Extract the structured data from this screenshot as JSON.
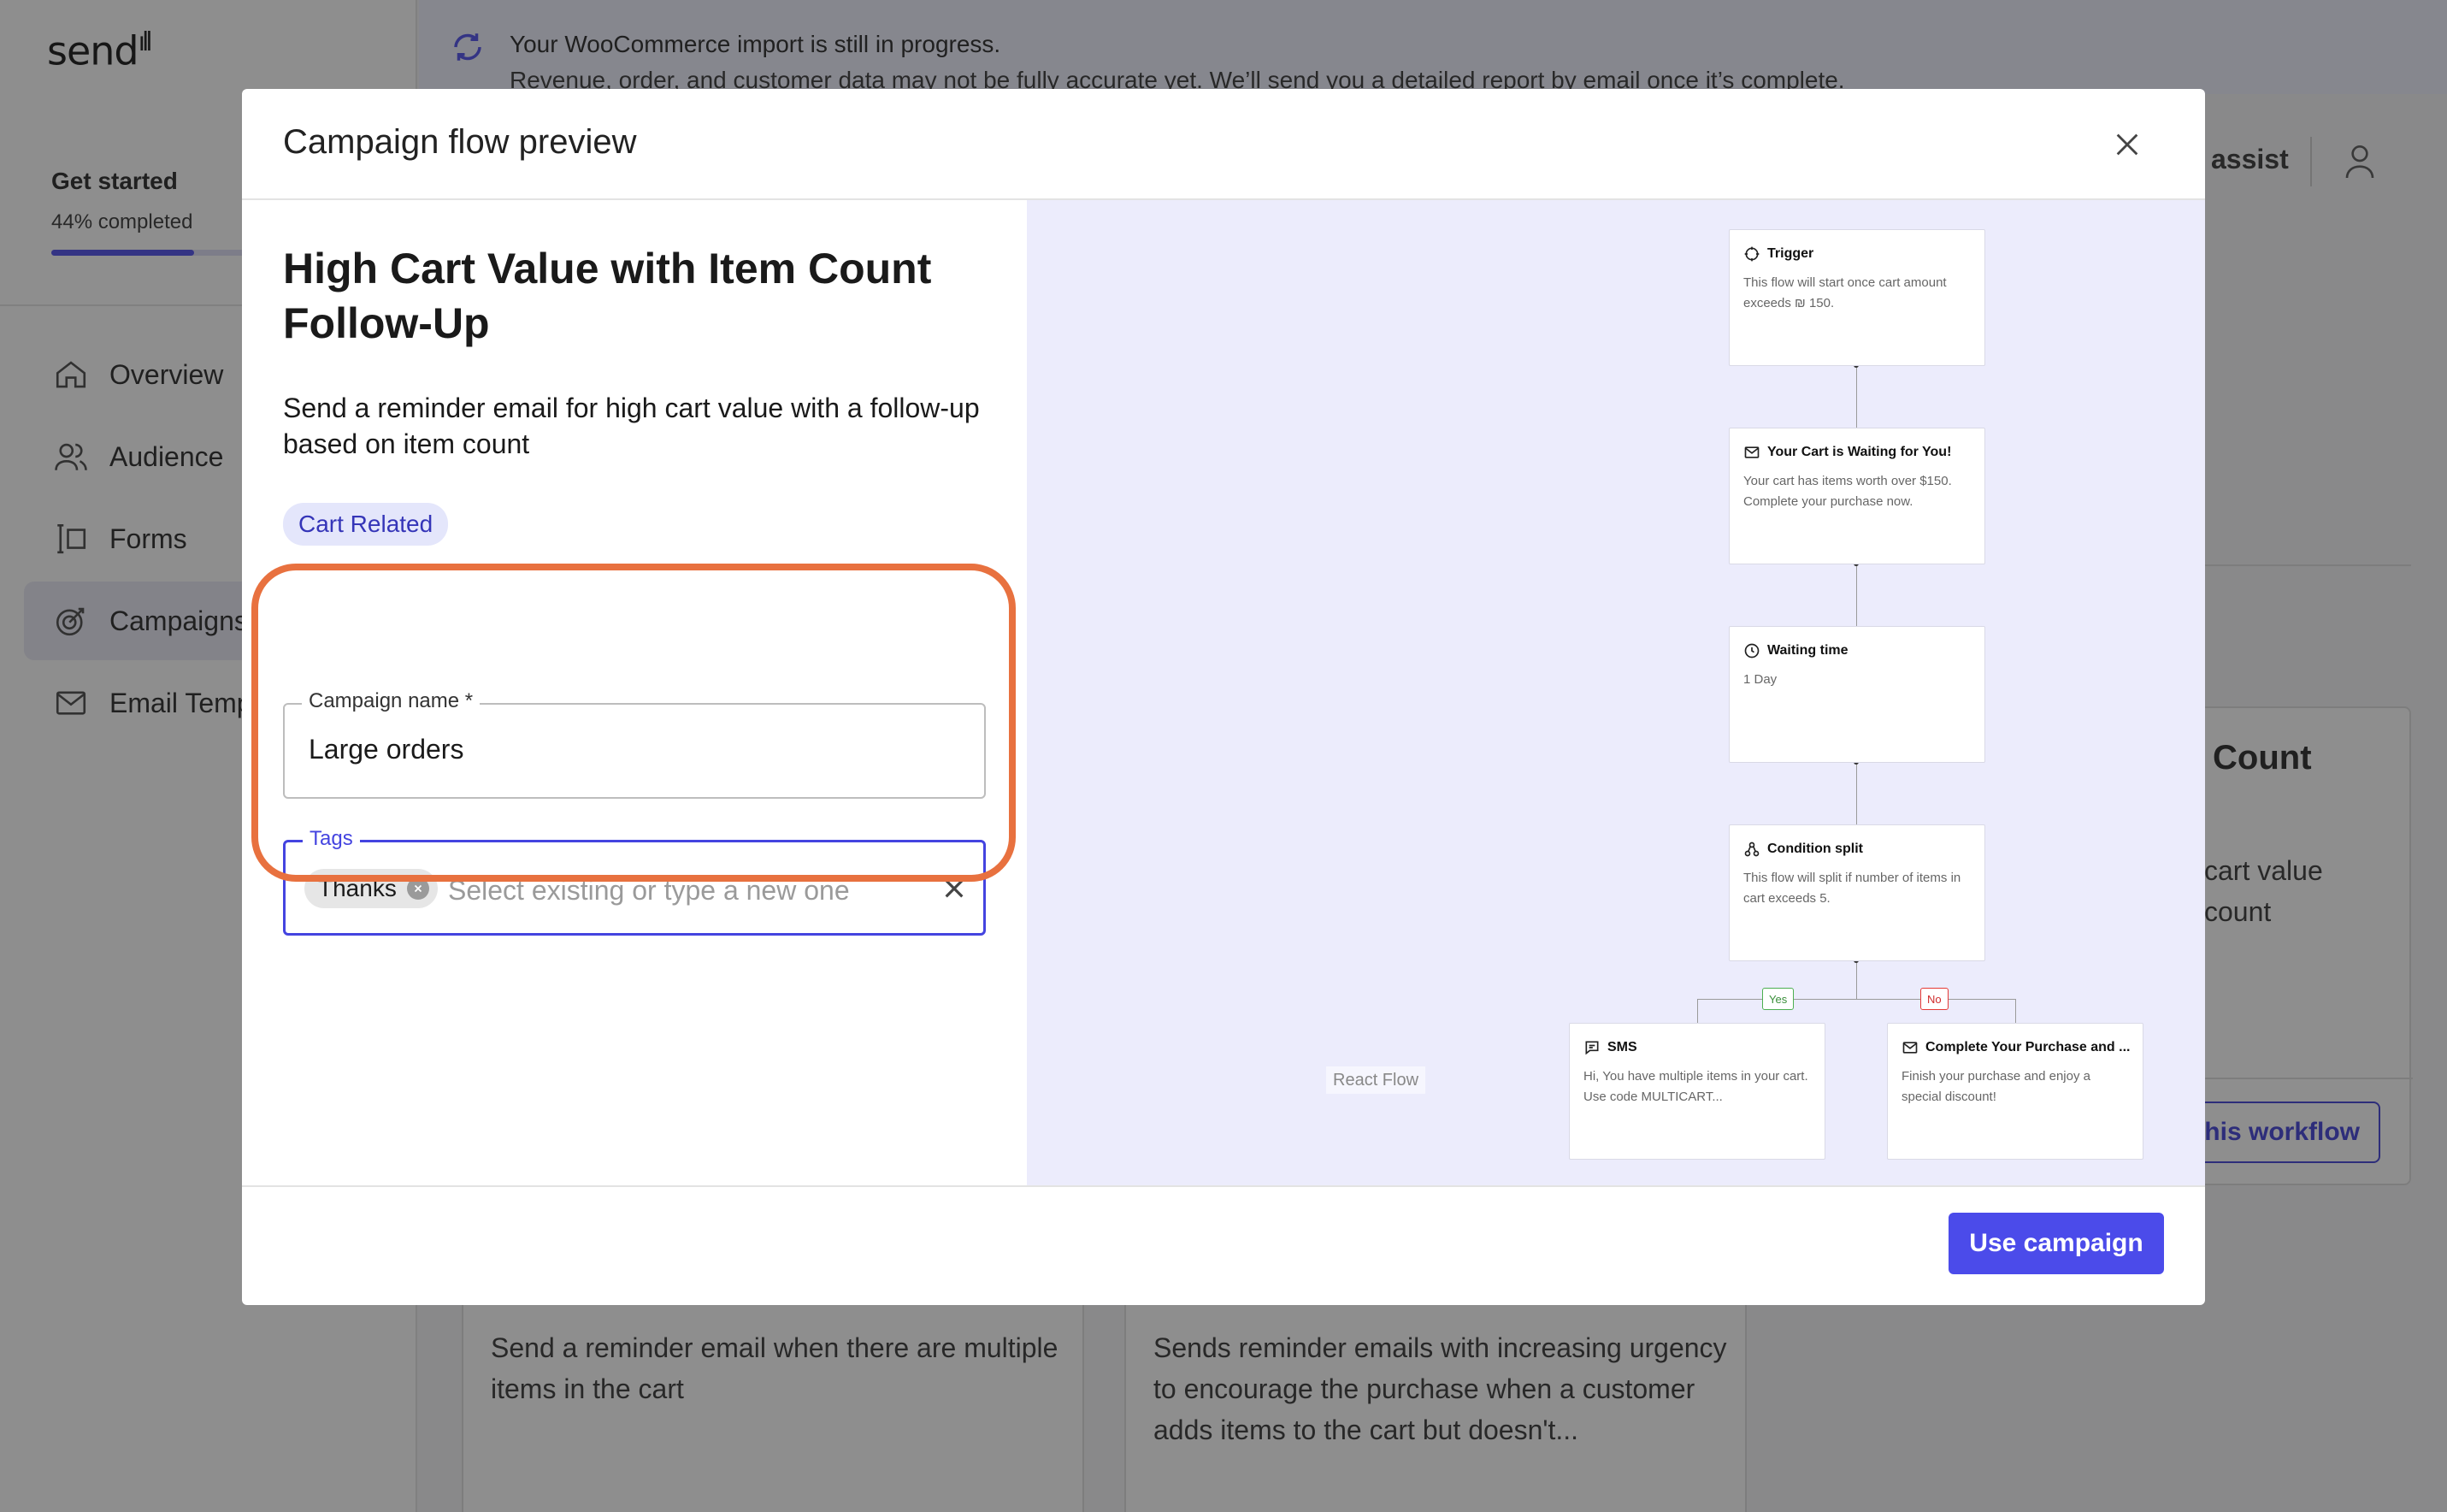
{
  "app": {
    "logo_text": "send",
    "banner": {
      "title": "Your WooCommerce import is still in progress.",
      "body": "Revenue, order, and customer data may not be fully accurate yet. We’ll send you a detailed report by email once it’s complete."
    },
    "get_started": {
      "title": "Get started",
      "progress_label": "44% completed",
      "progress": 0.44
    },
    "nav": [
      {
        "label": "Overview",
        "icon": "home-icon"
      },
      {
        "label": "Audience",
        "icon": "users-icon"
      },
      {
        "label": "Forms",
        "icon": "form-icon"
      },
      {
        "label": "Campaigns",
        "icon": "target-icon"
      },
      {
        "label": "Email Temp",
        "icon": "mail-icon"
      }
    ],
    "header": {
      "assist_label": "assist"
    },
    "bg_cards": {
      "right": {
        "title": "Count",
        "desc_line1": "cart value",
        "desc_line2": "count",
        "button": "this workflow"
      },
      "bottom1": {
        "desc": "Send a reminder email when there are multiple items in the cart"
      },
      "bottom2": {
        "desc": "Sends reminder emails with increasing urgency to encourage the purchase when a customer adds items to the cart but doesn't..."
      }
    }
  },
  "modal": {
    "title": "Campaign flow preview",
    "flow_title": "High Cart Value with Item Count Follow-Up",
    "flow_description": "Send a reminder email for high cart value with a follow-up based on item count",
    "category": "Cart Related",
    "campaign_name": {
      "label": "Campaign name *",
      "value": "Large orders"
    },
    "tags": {
      "label": "Tags",
      "chips": [
        "Thanks"
      ],
      "placeholder": "Select existing or type a new one"
    },
    "use_button": "Use campaign",
    "flow": {
      "nodes": [
        {
          "title": "Trigger",
          "icon": "trigger-icon",
          "desc": "This flow will start once cart amount exceeds ₪ 150."
        },
        {
          "title": "Your Cart is Waiting for You!",
          "icon": "mail-icon",
          "desc": "Your cart has items worth over $150. Complete your purchase now."
        },
        {
          "title": "Waiting time",
          "icon": "clock-icon",
          "desc": "1 Day"
        },
        {
          "title": "Condition split",
          "icon": "split-icon",
          "desc": "This flow will split if number of items in cart exceeds 5."
        },
        {
          "title": "SMS",
          "icon": "sms-icon",
          "desc": "Hi, You have multiple items in your cart. Use code MULTICART..."
        },
        {
          "title": "Complete Your Purchase and ...",
          "icon": "mail-icon",
          "desc": "Finish your purchase and enjoy a special discount!"
        }
      ],
      "branch_yes": "Yes",
      "branch_no": "No",
      "attribution": "React Flow"
    }
  }
}
